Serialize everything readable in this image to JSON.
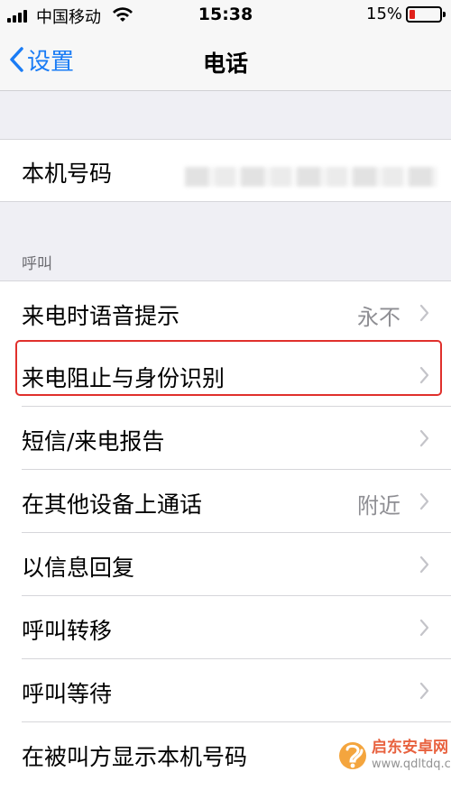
{
  "status_bar": {
    "carrier": "中国移动",
    "time": "15:38",
    "battery_percent": "15%",
    "battery_level": 0.15
  },
  "nav": {
    "back_label": "设置",
    "title": "电话"
  },
  "my_number": {
    "label": "本机号码"
  },
  "section_calls": {
    "header": "呼叫",
    "items": [
      {
        "label": "来电时语音提示",
        "value": "永不"
      },
      {
        "label": "来电阻止与身份识别",
        "value": ""
      },
      {
        "label": "短信/来电报告",
        "value": ""
      },
      {
        "label": "在其他设备上通话",
        "value": "附近"
      },
      {
        "label": "以信息回复",
        "value": ""
      },
      {
        "label": "呼叫转移",
        "value": ""
      },
      {
        "label": "呼叫等待",
        "value": ""
      },
      {
        "label": "在被叫方显示本机号码",
        "value": ""
      }
    ]
  },
  "watermark": {
    "name": "启东安卓网",
    "url": "www.qdltdq.com"
  },
  "colors": {
    "accent": "#1a7cf5",
    "highlight": "#e0302c",
    "battery_low": "#e0201a"
  }
}
